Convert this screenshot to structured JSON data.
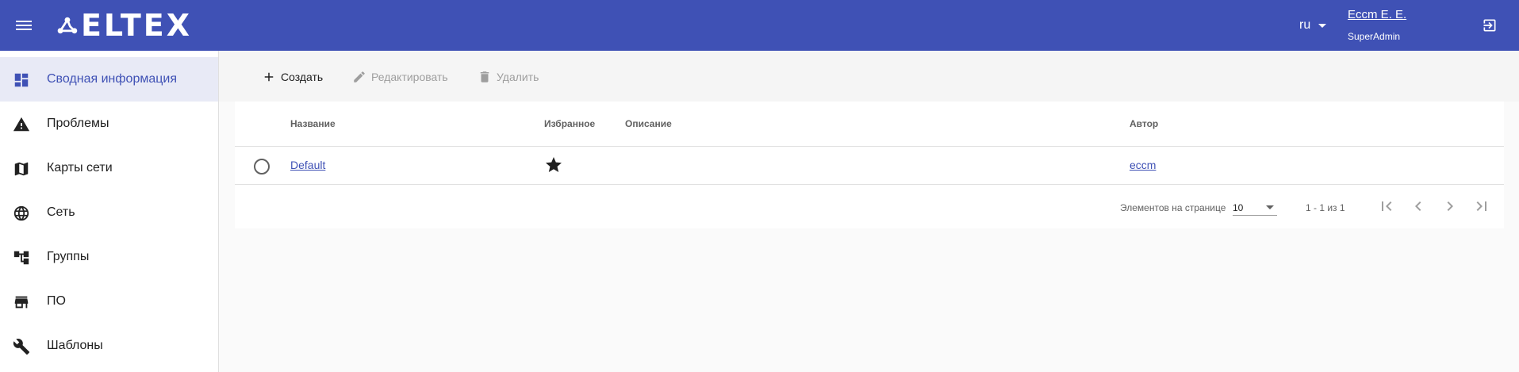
{
  "header": {
    "brand": "ELTEX",
    "language": "ru",
    "user_name": "Eccm E. E.",
    "user_role": "SuperAdmin",
    "menu_icon": "menu-icon",
    "logout_icon": "logout-icon",
    "accent_color": "#3f51b5"
  },
  "sidebar": {
    "items": [
      {
        "label": "Сводная информация",
        "icon": "dashboard-icon",
        "active": true
      },
      {
        "label": "Проблемы",
        "icon": "warning-icon"
      },
      {
        "label": "Карты сети",
        "icon": "map-icon"
      },
      {
        "label": "Сеть",
        "icon": "globe-icon"
      },
      {
        "label": "Группы",
        "icon": "groups-icon"
      },
      {
        "label": "ПО",
        "icon": "store-icon"
      },
      {
        "label": "Шаблоны",
        "icon": "wrench-icon"
      }
    ]
  },
  "toolbar": {
    "create_label": "Создать",
    "edit_label": "Редактировать",
    "delete_label": "Удалить"
  },
  "table": {
    "columns": [
      "Название",
      "Избранное",
      "Описание",
      "Автор"
    ],
    "rows": [
      {
        "name": "Default",
        "favorite": true,
        "description": "",
        "author": "eccm"
      }
    ]
  },
  "pagination": {
    "per_page_label": "Элементов на странице",
    "per_page_value": "10",
    "range": "1 - 1 из 1"
  }
}
